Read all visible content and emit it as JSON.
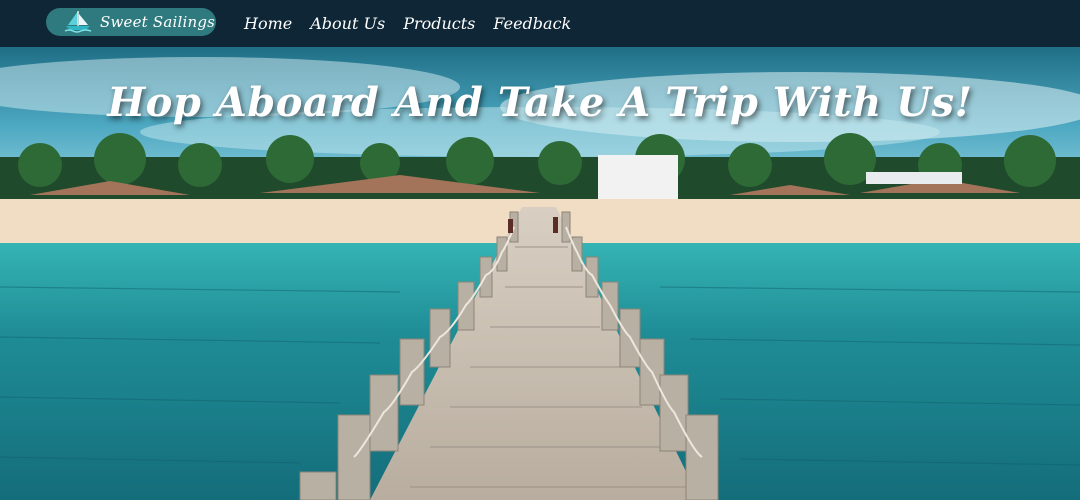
{
  "brand": {
    "name": "Sweet Sailings",
    "logo_icon": "sailboat-icon"
  },
  "nav": {
    "items": [
      {
        "label": "Home"
      },
      {
        "label": "About Us"
      },
      {
        "label": "Products"
      },
      {
        "label": "Feedback"
      }
    ]
  },
  "hero": {
    "title": "Hop Aboard And Take A Trip With Us!",
    "image_subject": "wooden-pier-over-turquoise-sea"
  },
  "colors": {
    "navbar_bg": "#0e2636",
    "brand_pill": "#2f7a7e",
    "nav_text": "#ffffff",
    "sea": "#1b8592",
    "sand": "#f1dcc4"
  }
}
